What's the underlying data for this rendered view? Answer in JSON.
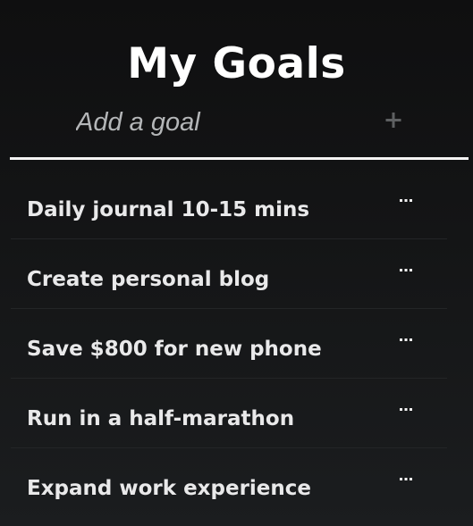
{
  "header": {
    "title": "My Goals"
  },
  "add_goal": {
    "placeholder": "Add a goal",
    "button_icon": "plus-icon"
  },
  "goals": [
    {
      "label": "Daily journal 10-15 mins",
      "menu_icon": "more-horizontal-icon"
    },
    {
      "label": "Create personal blog",
      "menu_icon": "more-horizontal-icon"
    },
    {
      "label": "Save $800 for new phone",
      "menu_icon": "more-horizontal-icon"
    },
    {
      "label": "Run in a half-marathon",
      "menu_icon": "more-horizontal-icon"
    },
    {
      "label": "Expand work experience",
      "menu_icon": "more-horizontal-icon"
    }
  ],
  "colors": {
    "background": "#111213",
    "text": "#e9e9ea",
    "underline": "#f4f4f4",
    "placeholder": "#b4b6b8",
    "plus_icon": "#5e6062"
  }
}
